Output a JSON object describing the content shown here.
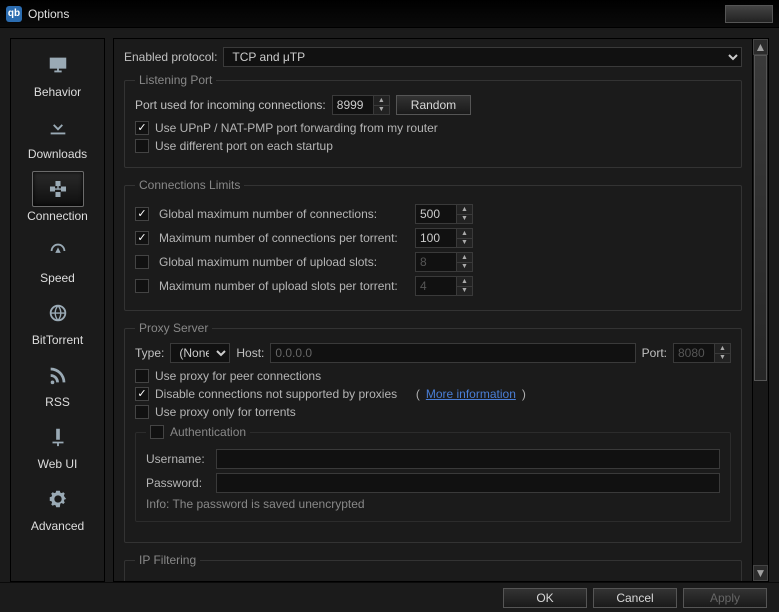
{
  "title": "Options",
  "sidebar": {
    "items": [
      {
        "label": "Behavior"
      },
      {
        "label": "Downloads"
      },
      {
        "label": "Connection"
      },
      {
        "label": "Speed"
      },
      {
        "label": "BitTorrent"
      },
      {
        "label": "RSS"
      },
      {
        "label": "Web UI"
      },
      {
        "label": "Advanced"
      }
    ]
  },
  "main": {
    "enabled_protocol_label": "Enabled protocol:",
    "enabled_protocol_value": "TCP and μTP",
    "listening_port": {
      "legend": "Listening Port",
      "port_label": "Port used for incoming connections:",
      "port_value": "8999",
      "random_label": "Random",
      "upnp_label": "Use UPnP / NAT-PMP port forwarding from my router",
      "diff_port_label": "Use different port on each startup"
    },
    "conn_limits": {
      "legend": "Connections Limits",
      "global_max_label": "Global maximum number of connections:",
      "global_max_value": "500",
      "max_per_torrent_label": "Maximum number of connections per torrent:",
      "max_per_torrent_value": "100",
      "global_upload_label": "Global maximum number of upload slots:",
      "global_upload_value": "8",
      "upload_per_torrent_label": "Maximum number of upload slots per torrent:",
      "upload_per_torrent_value": "4"
    },
    "proxy": {
      "legend": "Proxy Server",
      "type_label": "Type:",
      "type_value": "(None)",
      "host_label": "Host:",
      "host_value": "0.0.0.0",
      "port_label": "Port:",
      "port_value": "8080",
      "peer_label": "Use proxy for peer connections",
      "disable_unsupported_label": "Disable connections not supported by proxies",
      "more_info": "More information",
      "torrents_only_label": "Use proxy only for torrents",
      "auth_legend": "Authentication",
      "username_label": "Username:",
      "password_label": "Password:",
      "info": "Info: The password is saved unencrypted"
    },
    "ip_filter": {
      "legend": "IP Filtering"
    }
  },
  "footer": {
    "ok": "OK",
    "cancel": "Cancel",
    "apply": "Apply"
  }
}
